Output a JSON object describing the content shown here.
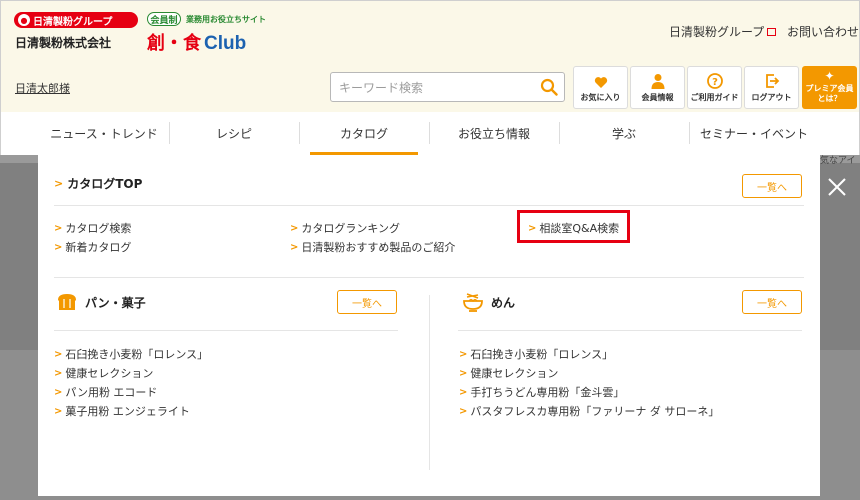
{
  "header": {
    "group_badge": "日清製粉グループ",
    "company_name": "日清製粉株式会社",
    "club_badge": "会員制",
    "club_tagline": "業務用お役立ちサイト",
    "club_logo_kanji": "創・食",
    "club_logo_word": "Club",
    "link_group": "日清製粉グループ",
    "link_contact": "お問い合わせ"
  },
  "userbar": {
    "user_name": "日清太郎様",
    "search_placeholder": "キーワード検索",
    "buttons": [
      {
        "label": "お気に入り",
        "icon": "heart-icon"
      },
      {
        "label": "会員情報",
        "icon": "person-icon"
      },
      {
        "label": "ご利用ガイド",
        "icon": "question-icon"
      },
      {
        "label": "ログアウト",
        "icon": "logout-icon"
      }
    ],
    "premium": {
      "line1": "プレミア会員",
      "line2": "とは？",
      "icon": "sparkle-icon"
    }
  },
  "nav": {
    "items": [
      "ニュース・トレンド",
      "レシピ",
      "カタログ",
      "お役立ち情報",
      "学ぶ",
      "セミナー・イベント"
    ],
    "active": "カタログ"
  },
  "background_peek": "気なアイ",
  "panel": {
    "top_title": "カタログTOP",
    "list_button": "一覧へ",
    "top_links": [
      [
        "カタログ検索",
        "新着カタログ"
      ],
      [
        "カタログランキング",
        "日清製粉おすすめ製品のご紹介"
      ],
      [
        "相談室Q&A検索"
      ]
    ],
    "sections": [
      {
        "title": "パン・菓子",
        "icon": "bread-icon",
        "list_button": "一覧へ",
        "links": [
          "石臼挽き小麦粉「ロレンス」",
          "健康セレクション",
          "パン用粉 エコード",
          "菓子用粉 エンジェライト"
        ]
      },
      {
        "title": "めん",
        "icon": "noodle-bowl-icon",
        "list_button": "一覧へ",
        "links": [
          "石臼挽き小麦粉「ロレンス」",
          "健康セレクション",
          "手打ちうどん専用粉「金斗雲」",
          "パスタフレスカ専用粉「ファリーナ ダ サローネ」"
        ]
      }
    ]
  },
  "colors": {
    "accent": "#f39800",
    "brand_red": "#e60012",
    "club_blue": "#1c62b0",
    "club_green": "#2a8a32"
  }
}
